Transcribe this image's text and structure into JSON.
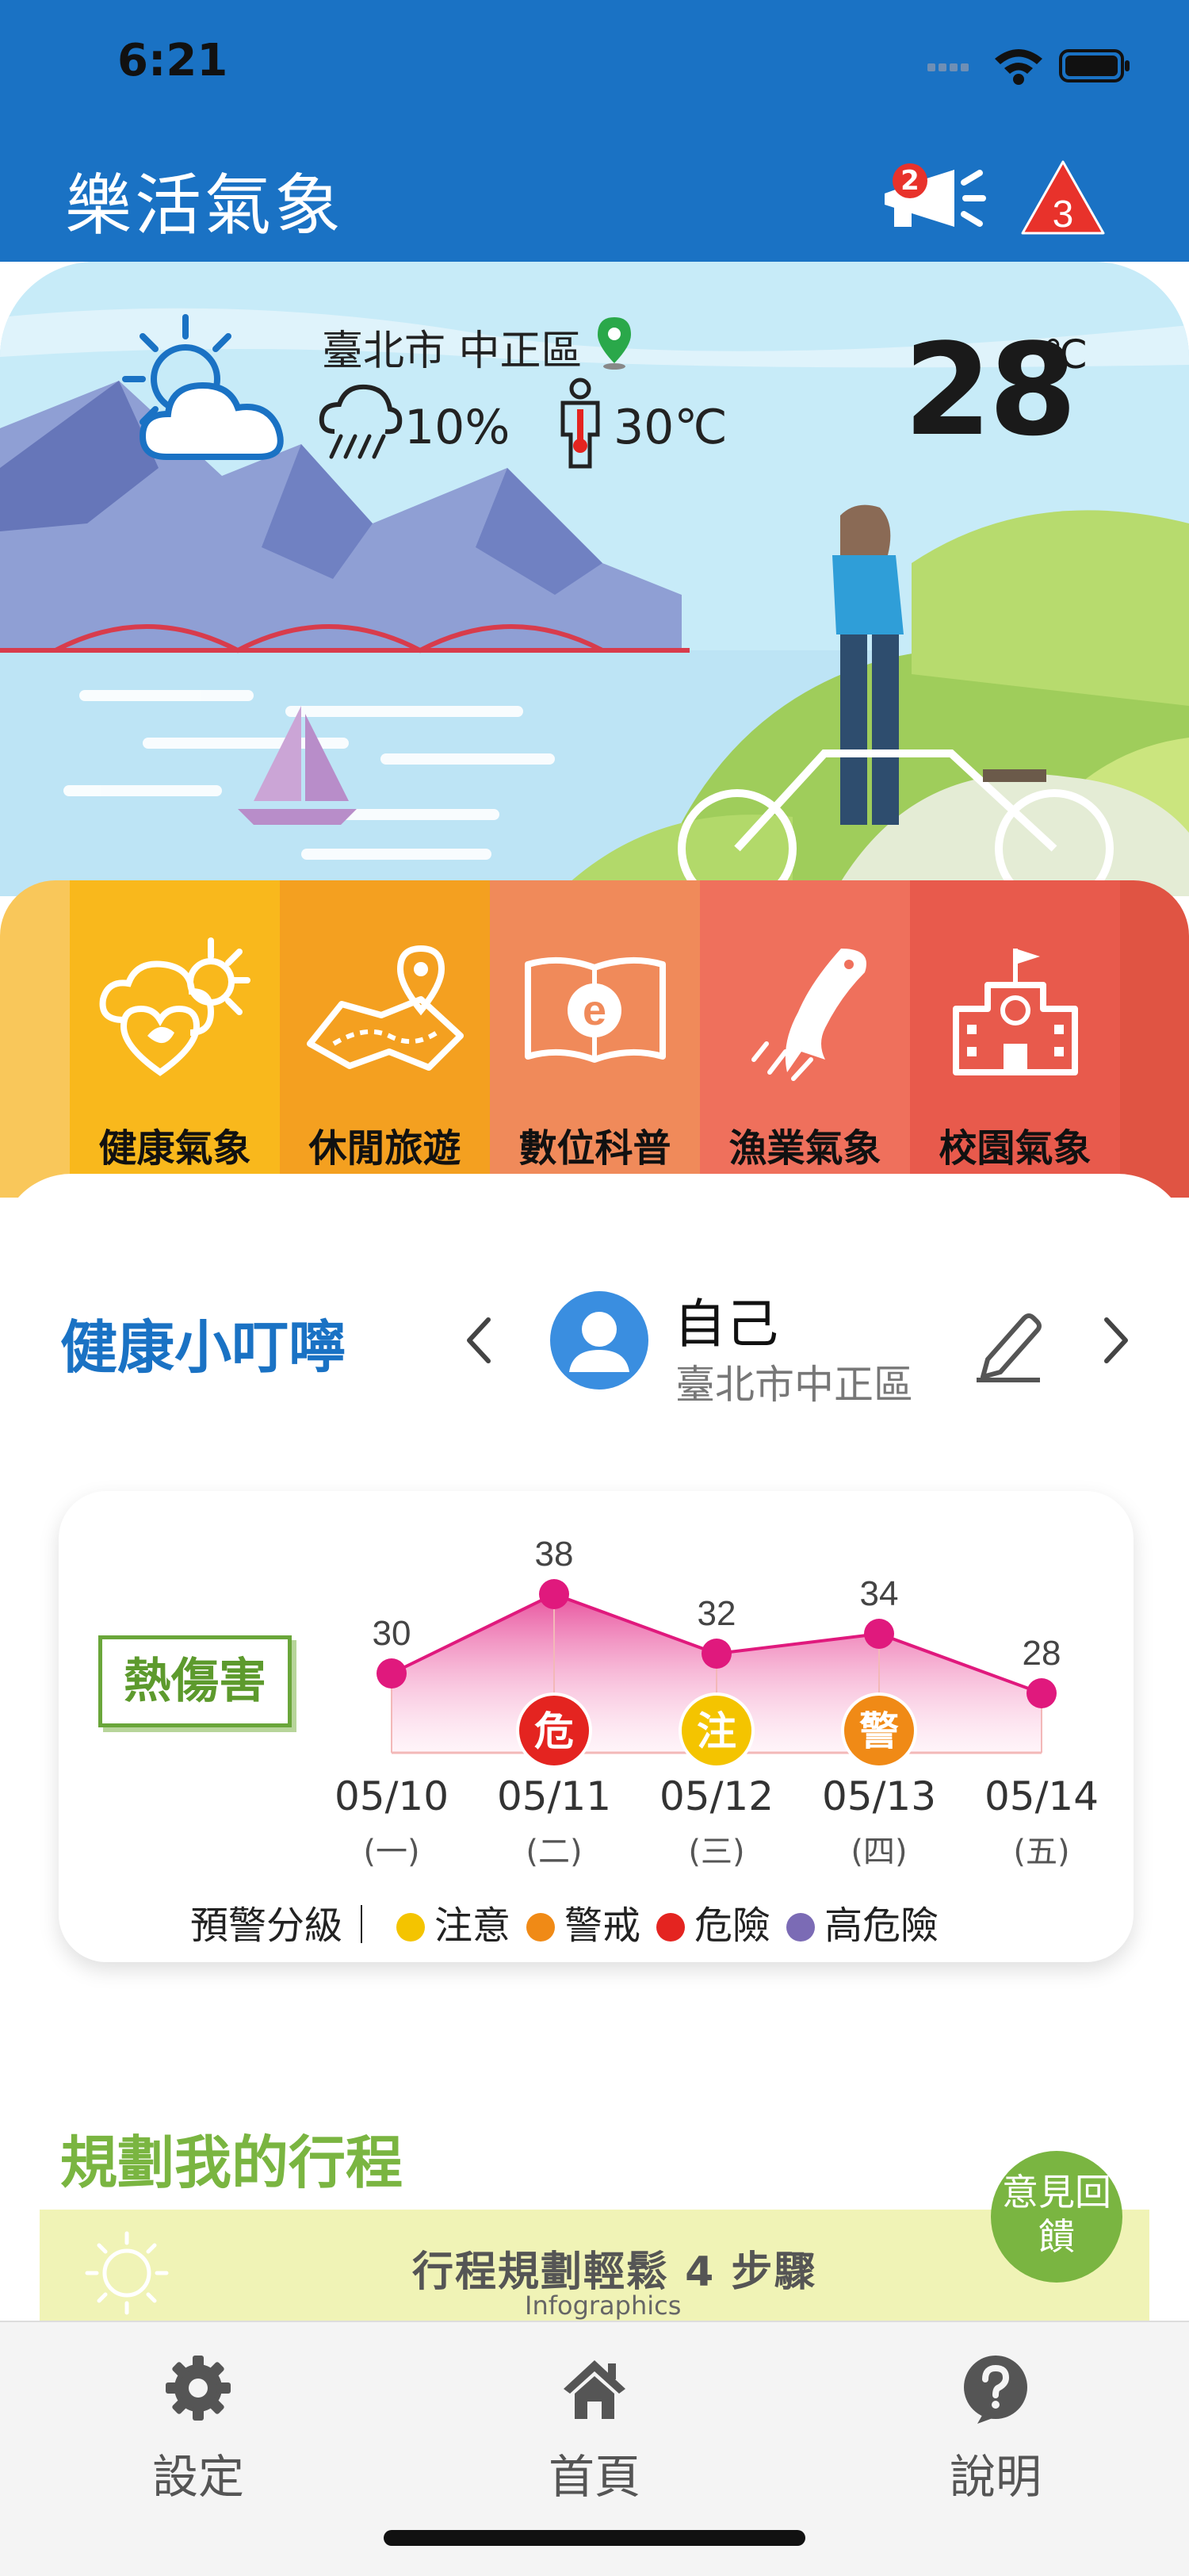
{
  "status_bar": {
    "time": "6:21"
  },
  "header": {
    "title": "樂活氣象",
    "notification_count": "2",
    "alert_count": "3"
  },
  "weather": {
    "location": "臺北市 中正區",
    "rain_probability": "10%",
    "feels_like": "30℃",
    "temperature": "28",
    "temperature_unit": "℃"
  },
  "categories": [
    {
      "label": "健康氣象",
      "icon": "sun-cloud-heart-icon",
      "color": "#f9b81c"
    },
    {
      "label": "休閒旅遊",
      "icon": "map-pin-icon",
      "color": "#f4a020"
    },
    {
      "label": "數位科普",
      "icon": "e-book-icon",
      "color": "#f08a5a"
    },
    {
      "label": "漁業氣象",
      "icon": "fish-icon",
      "color": "#ef705c"
    },
    {
      "label": "校園氣象",
      "icon": "school-icon",
      "color": "#e85a4c"
    }
  ],
  "health": {
    "title": "健康小叮嚀",
    "person_name": "自己",
    "person_location": "臺北市中正區"
  },
  "chart_data": {
    "type": "line",
    "title": "熱傷害",
    "categories": [
      "05/10",
      "05/11",
      "05/12",
      "05/13",
      "05/14"
    ],
    "weekdays": [
      "(一)",
      "(二)",
      "(三)",
      "(四)",
      "(五)"
    ],
    "values": [
      30,
      38,
      32,
      34,
      28
    ],
    "warnings": [
      "",
      "危",
      "注",
      "警",
      ""
    ],
    "warning_colors": {
      "注": "#f4c400",
      "警": "#f08a16",
      "危": "#e42420"
    },
    "line_color": "#e0197d",
    "legend": {
      "label": "預警分級｜",
      "items": [
        {
          "name": "注意",
          "color": "#f4c400"
        },
        {
          "name": "警戒",
          "color": "#f08a16"
        },
        {
          "name": "危險",
          "color": "#e42420"
        },
        {
          "name": "高危險",
          "color": "#7b6bb5"
        }
      ]
    }
  },
  "plan": {
    "title": "規劃我的行程",
    "feedback_label": "意見回饋",
    "infographic_title": "行程規劃輕鬆 4 步驟",
    "infographic_sub": "Infographics"
  },
  "tabs": [
    {
      "label": "設定",
      "icon": "gear-icon"
    },
    {
      "label": "首頁",
      "icon": "home-icon"
    },
    {
      "label": "說明",
      "icon": "help-icon"
    }
  ]
}
